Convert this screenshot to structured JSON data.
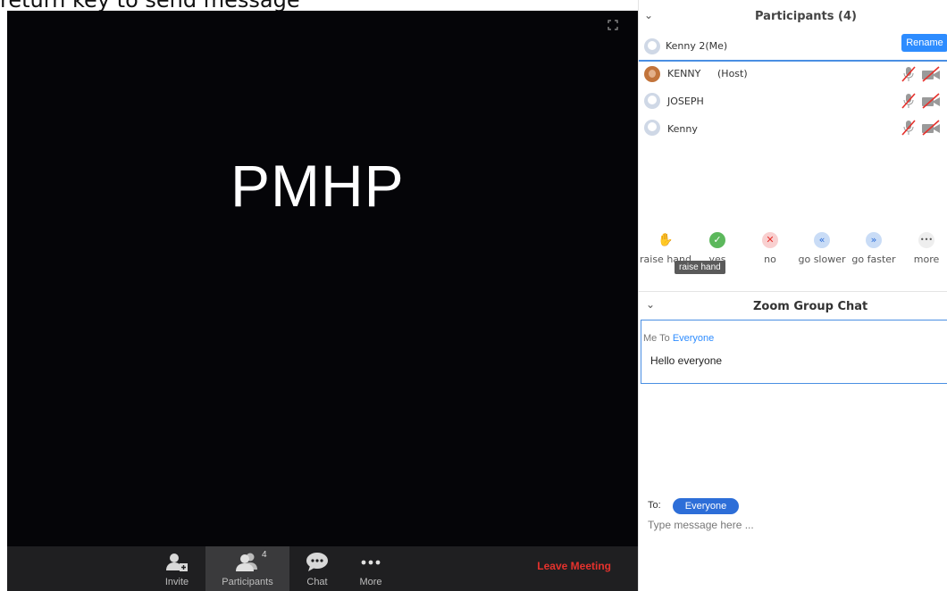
{
  "caption": "return key to send message",
  "video": {
    "participant_name": "PMHP"
  },
  "toolbar": {
    "invite_label": "Invite",
    "participants_label": "Participants",
    "participants_count": "4",
    "chat_label": "Chat",
    "more_label": "More",
    "leave_label": "Leave Meeting"
  },
  "participants_panel": {
    "title": "Participants (4)",
    "me": {
      "name": "Kenny 2(Me)",
      "rename_label": "Rename"
    },
    "list": [
      {
        "name": "KENNY",
        "role": "(Host)",
        "avatar": "photo",
        "muted": true,
        "video_off": true
      },
      {
        "name": "JOSEPH",
        "role": "",
        "avatar": "default",
        "muted": true,
        "video_off": true
      },
      {
        "name": "Kenny",
        "role": "",
        "avatar": "default",
        "muted": true,
        "video_off": true
      }
    ],
    "reactions": [
      {
        "label": "raise hand",
        "icon": "raise-hand-icon",
        "color": "#f0a030",
        "glyph": "✋"
      },
      {
        "label": "yes",
        "icon": "check-icon",
        "color": "#5cb85c",
        "glyph": "✓"
      },
      {
        "label": "no",
        "icon": "x-icon",
        "color": "#f9c6c6",
        "glyph": "✕"
      },
      {
        "label": "go slower",
        "icon": "go-slower-icon",
        "color": "#c9dcf6",
        "glyph": "«"
      },
      {
        "label": "go faster",
        "icon": "go-faster-icon",
        "color": "#c9dcf6",
        "glyph": "»"
      },
      {
        "label": "more",
        "icon": "more-icon",
        "color": "#eeeeee",
        "glyph": "•••"
      }
    ],
    "tooltip": "raise hand"
  },
  "chat_panel": {
    "title": "Zoom Group Chat",
    "message_meta_from": "Me To ",
    "message_meta_to": "Everyone",
    "message_text": "Hello everyone",
    "to_label": "To:",
    "recipient": "Everyone",
    "input_placeholder": "Type message here ..."
  },
  "colors": {
    "accent": "#2d8cff",
    "leave": "#e5322d",
    "toolbar_bg": "#1f1f21",
    "video_bg": "#050508"
  }
}
